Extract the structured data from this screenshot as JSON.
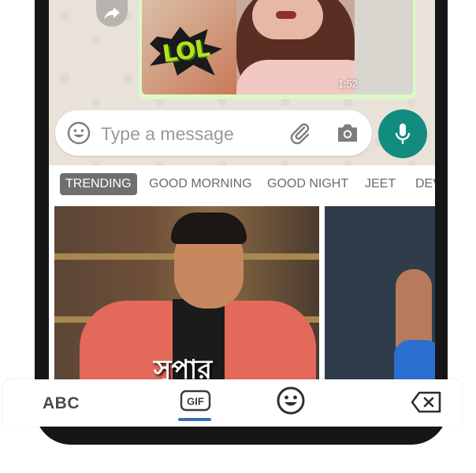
{
  "chat": {
    "message_time": "1:52",
    "sticker_text": "LOL"
  },
  "composer": {
    "placeholder": "Type a message",
    "icons": {
      "emoji": "smiley-icon",
      "attach": "paperclip-icon",
      "camera": "camera-icon",
      "mic": "mic-icon"
    }
  },
  "gif_categories": [
    {
      "label": "TRENDING",
      "active": true
    },
    {
      "label": "GOOD MORNING",
      "active": false
    },
    {
      "label": "GOOD NIGHT",
      "active": false
    },
    {
      "label": "JEET",
      "active": false
    },
    {
      "label": "DEV",
      "active": false
    }
  ],
  "gif_results": [
    {
      "caption": "সুপার"
    },
    {
      "caption": ""
    }
  ],
  "keyboard_bar": {
    "abc_label": "ABC",
    "gif_label": "GIF",
    "icons": {
      "emoji": "smiley-icon",
      "delete": "backspace-icon"
    }
  },
  "colors": {
    "accent_green": "#128c7e",
    "bubble_green": "#dcf8c6",
    "active_tab": "#6f6f6f",
    "indicator_blue": "#3b6fb6"
  }
}
